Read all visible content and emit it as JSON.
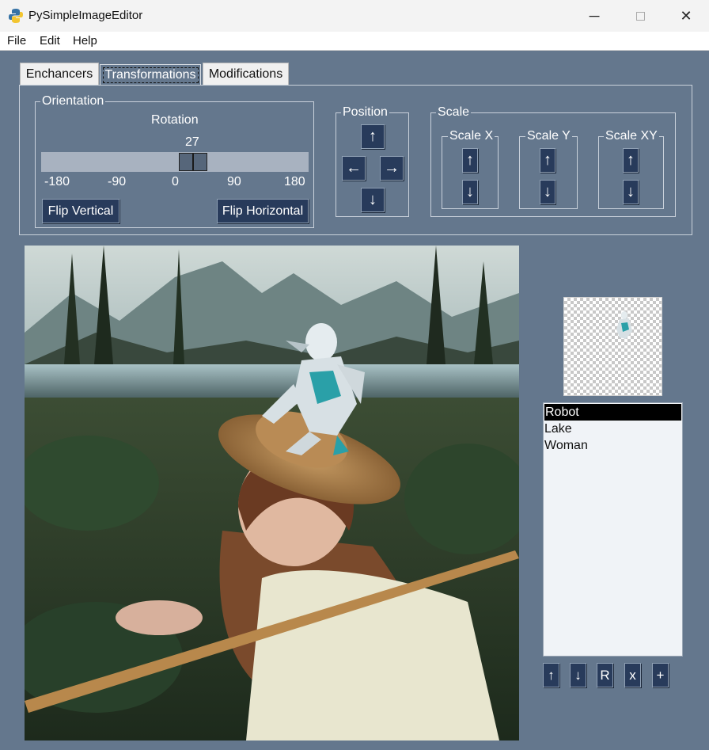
{
  "window": {
    "title": "PySimpleImageEditor",
    "min_icon": "minimize-icon",
    "max_icon": "maximize-icon",
    "close_icon": "close-icon"
  },
  "menu": {
    "items": [
      "File",
      "Edit",
      "Help"
    ]
  },
  "tabs": [
    {
      "label": "Enchancers",
      "active": false
    },
    {
      "label": "Transformations",
      "active": true
    },
    {
      "label": "Modifications",
      "active": false
    }
  ],
  "orientation": {
    "frame_label": "Orientation",
    "rotation_label": "Rotation",
    "rotation_value": "27",
    "slider": {
      "min": -180,
      "max": 180,
      "value": 27
    },
    "ticks": [
      "-180",
      "-90",
      "0",
      "90",
      "180"
    ],
    "flip_vertical": "Flip Vertical",
    "flip_horizontal": "Flip Horizontal"
  },
  "position": {
    "frame_label": "Position",
    "up": "↑",
    "left": "←",
    "right": "→",
    "down": "↓"
  },
  "scale": {
    "frame_label": "Scale",
    "groups": [
      {
        "label": "Scale X",
        "up": "↑",
        "down": "↓"
      },
      {
        "label": "Scale Y",
        "up": "↑",
        "down": "↓"
      },
      {
        "label": "Scale XY",
        "up": "↑",
        "down": "↓"
      }
    ]
  },
  "layers": {
    "items": [
      "Robot",
      "Lake",
      "Woman"
    ],
    "selected": "Robot",
    "buttons": [
      "↑",
      "↓",
      "R",
      "x",
      "+"
    ]
  },
  "colors": {
    "window_bg": "#64778d",
    "button_bg": "#283b5b",
    "list_bg": "#f0f3f7",
    "selection": "#000000"
  }
}
